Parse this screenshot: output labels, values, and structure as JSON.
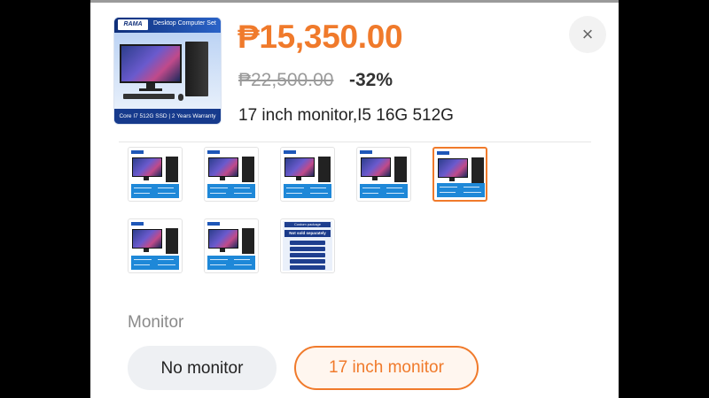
{
  "product": {
    "image_header_logo": "RAMA",
    "image_header_title": "Desktop Computer Set",
    "image_footer": "Core I7 512G SSD  |  2 Years Warranty",
    "price": "₱15,350.00",
    "original_price": "₱22,500.00",
    "discount": "-32%",
    "selected_variant": "17 inch monitor,I5 16G 512G"
  },
  "close_icon": "×",
  "thumbnails": [
    {
      "kind": "pc",
      "selected": false
    },
    {
      "kind": "pc",
      "selected": false
    },
    {
      "kind": "pc",
      "selected": false
    },
    {
      "kind": "pc",
      "selected": false
    },
    {
      "kind": "pc",
      "selected": true
    },
    {
      "kind": "pc",
      "selected": false
    },
    {
      "kind": "pc",
      "selected": false
    },
    {
      "kind": "custom",
      "selected": false
    }
  ],
  "custom_thumb": {
    "title": "Custom package",
    "banner": "Not sold separately"
  },
  "monitor_section": {
    "label": "Monitor",
    "options": [
      "No monitor",
      "17 inch monitor"
    ],
    "selected_index": 1
  },
  "colors": {
    "accent": "#f07a2b",
    "text": "#222222",
    "muted": "#8a8a8a"
  }
}
